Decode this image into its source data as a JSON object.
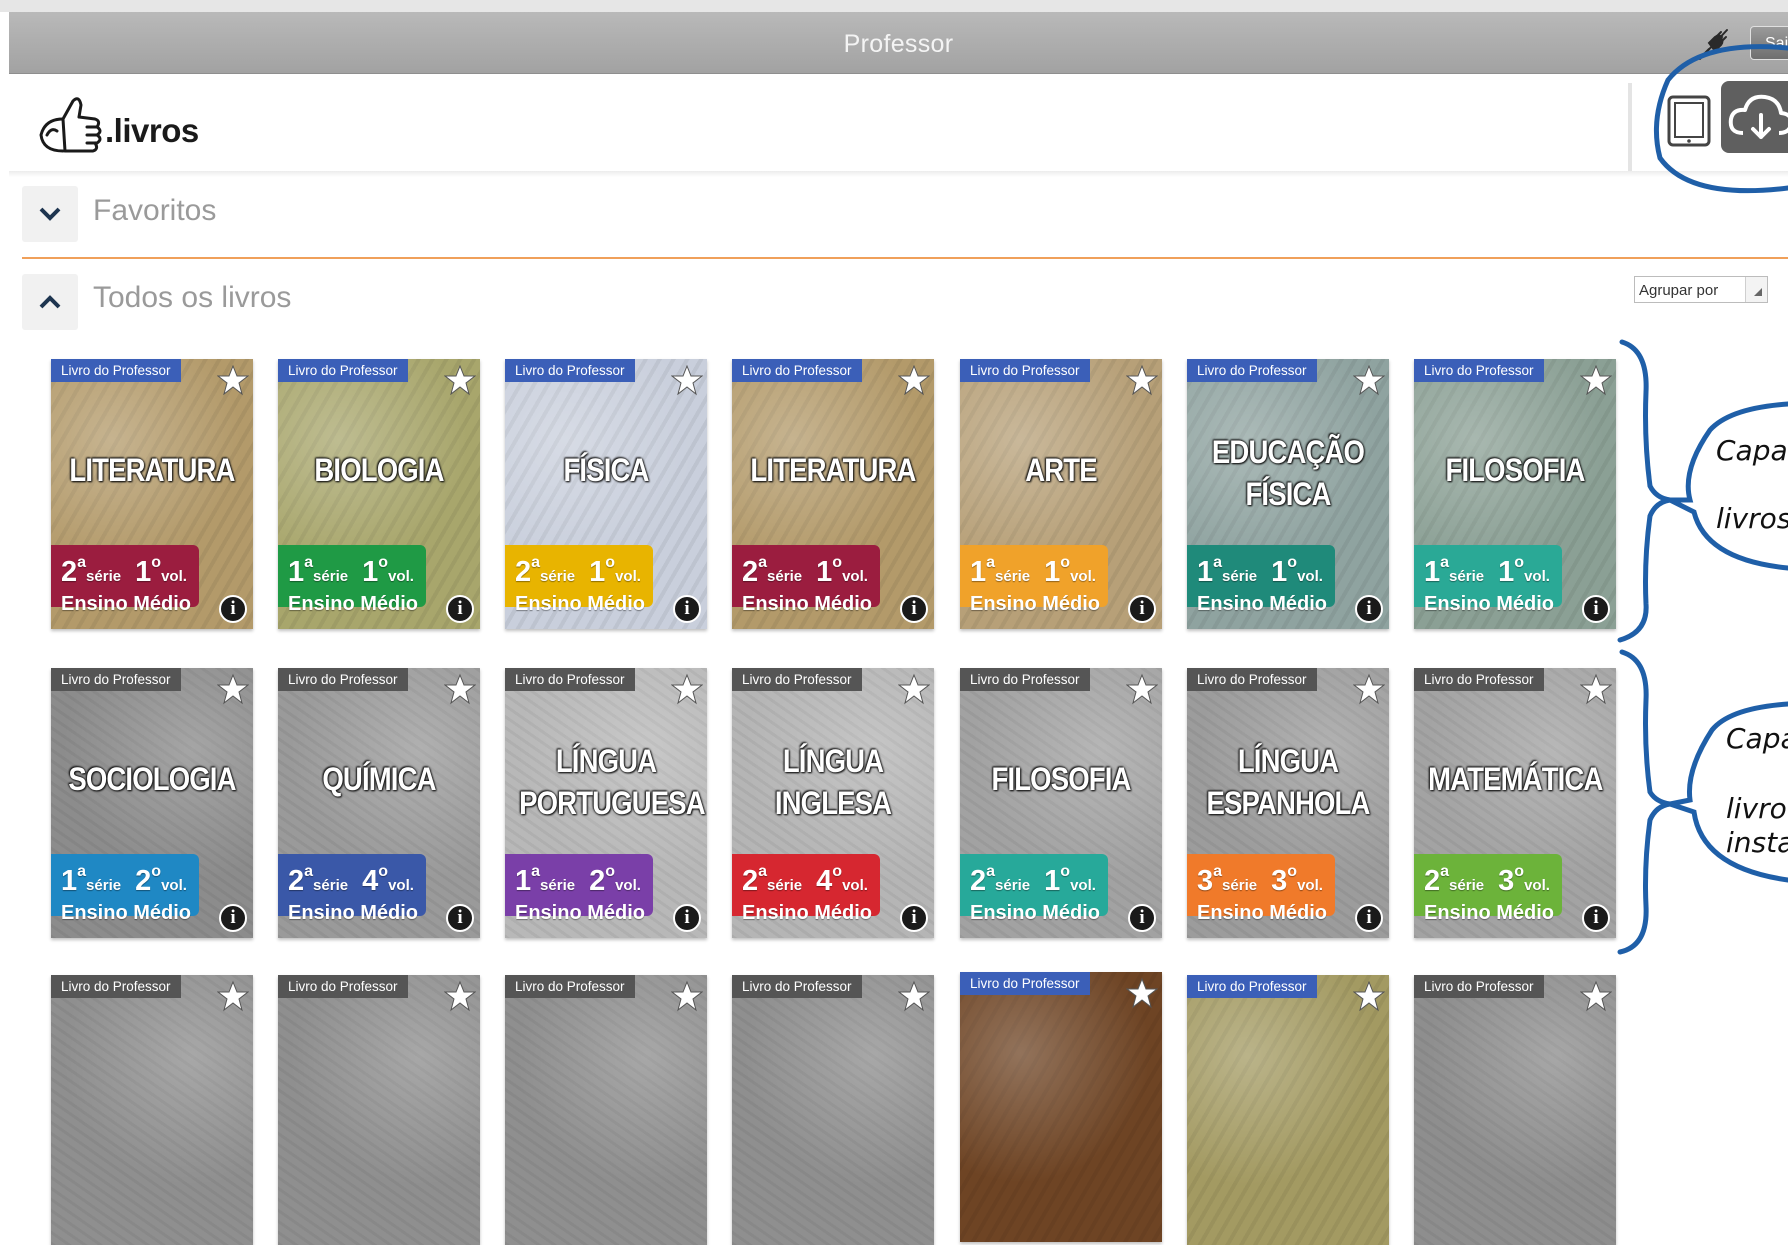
{
  "titlebar": {
    "title": "Professor",
    "logout_label": "Sair"
  },
  "header": {
    "logo_text": ".livros"
  },
  "sections": {
    "favorites_label": "Favoritos",
    "all_books_label": "Todos os livros",
    "group_by_placeholder": "Agrupar por"
  },
  "book_tag": "Livro do Professor",
  "books": [
    {
      "subject": [
        "LITERATURA"
      ],
      "serie": "2",
      "vol": "1",
      "level": "Ensino Médio",
      "tag_color": "#3b5fb8",
      "badge_color": "#9b1d3f",
      "bg": "#b39a6a",
      "installed": false
    },
    {
      "subject": [
        "BIOLOGIA"
      ],
      "serie": "1",
      "vol": "1",
      "level": "Ensino Médio",
      "tag_color": "#3b5fb8",
      "badge_color": "#1f9a45",
      "bg": "#a8a66c",
      "installed": false
    },
    {
      "subject": [
        "FÍSICA"
      ],
      "serie": "2",
      "vol": "1",
      "level": "Ensino Médio",
      "tag_color": "#3b5fb8",
      "badge_color": "#e8b400",
      "bg": "#c9cfdc",
      "installed": false
    },
    {
      "subject": [
        "LITERATURA"
      ],
      "serie": "2",
      "vol": "1",
      "level": "Ensino Médio",
      "tag_color": "#3b5fb8",
      "badge_color": "#9b1d3f",
      "bg": "#b39a6a",
      "installed": false
    },
    {
      "subject": [
        "ARTE"
      ],
      "serie": "1",
      "vol": "1",
      "level": "Ensino Médio",
      "tag_color": "#3b5fb8",
      "badge_color": "#f0a22a",
      "bg": "#b7a078",
      "installed": false
    },
    {
      "subject": [
        "EDUCAÇÃO",
        "FÍSICA"
      ],
      "serie": "1",
      "vol": "1",
      "level": "Ensino Médio",
      "tag_color": "#3b5fb8",
      "badge_color": "#1f8a7a",
      "bg": "#8fa3a0",
      "installed": false
    },
    {
      "subject": [
        "FILOSOFIA"
      ],
      "serie": "1",
      "vol": "1",
      "level": "Ensino Médio",
      "tag_color": "#3b5fb8",
      "badge_color": "#2aa996",
      "bg": "#8ba095",
      "installed": false
    },
    {
      "subject": [
        "SOCIOLOGIA"
      ],
      "serie": "1",
      "vol": "2",
      "level": "Ensino Médio",
      "tag_color": "#555555",
      "badge_color": "#1f88c4",
      "bg": "#8c8c8c",
      "installed": true
    },
    {
      "subject": [
        "QUÍMICA"
      ],
      "serie": "2",
      "vol": "4",
      "level": "Ensino Médio",
      "tag_color": "#555555",
      "badge_color": "#3a58a8",
      "bg": "#9a9a9a",
      "installed": true
    },
    {
      "subject": [
        "LÍNGUA",
        "PORTUGUESA"
      ],
      "serie": "1",
      "vol": "2",
      "level": "Ensino Médio",
      "tag_color": "#555555",
      "badge_color": "#7a3fa8",
      "bg": "#b8b8b8",
      "installed": true
    },
    {
      "subject": [
        "LÍNGUA",
        "INGLESA"
      ],
      "serie": "2",
      "vol": "4",
      "level": "Ensino Médio",
      "tag_color": "#555555",
      "badge_color": "#d62730",
      "bg": "#b5b5b5",
      "installed": true
    },
    {
      "subject": [
        "FILOSOFIA"
      ],
      "serie": "2",
      "vol": "1",
      "level": "Ensino Médio",
      "tag_color": "#555555",
      "badge_color": "#27a99a",
      "bg": "#a2a2a2",
      "installed": true
    },
    {
      "subject": [
        "LÍNGUA",
        "ESPANHOLA"
      ],
      "serie": "3",
      "vol": "3",
      "level": "Ensino Médio",
      "tag_color": "#555555",
      "badge_color": "#f07a2a",
      "bg": "#9c9c9c",
      "installed": true
    },
    {
      "subject": [
        "MATEMÁTICA"
      ],
      "serie": "2",
      "vol": "3",
      "level": "Ensino Médio",
      "tag_color": "#555555",
      "badge_color": "#6cb33a",
      "bg": "#a3a3a3",
      "installed": true
    },
    {
      "subject": [],
      "tag_color": "#555555",
      "bg": "#8f8f8f",
      "installed": true
    },
    {
      "subject": [],
      "tag_color": "#555555",
      "bg": "#8f8f8f",
      "installed": true
    },
    {
      "subject": [],
      "tag_color": "#555555",
      "bg": "#8f8f8f",
      "installed": true
    },
    {
      "subject": [],
      "tag_color": "#555555",
      "bg": "#8f8f8f",
      "installed": true
    },
    {
      "subject": [],
      "tag_color": "#3b5fb8",
      "bg": "#6e4424",
      "installed": false
    },
    {
      "subject": [],
      "tag_color": "#3b5fb8",
      "bg": "#a39a62",
      "installed": false
    },
    {
      "subject": [],
      "tag_color": "#555555",
      "bg": "#8e8e8e",
      "installed": true
    }
  ],
  "serie_suffix": "a",
  "serie_word": "série",
  "vol_suffix": "o",
  "vol_word": "vol.",
  "annotations": [
    {
      "lines": [
        "Capa",
        "livros"
      ]
    },
    {
      "lines": [
        "Capa",
        "livro",
        "insta"
      ]
    }
  ]
}
